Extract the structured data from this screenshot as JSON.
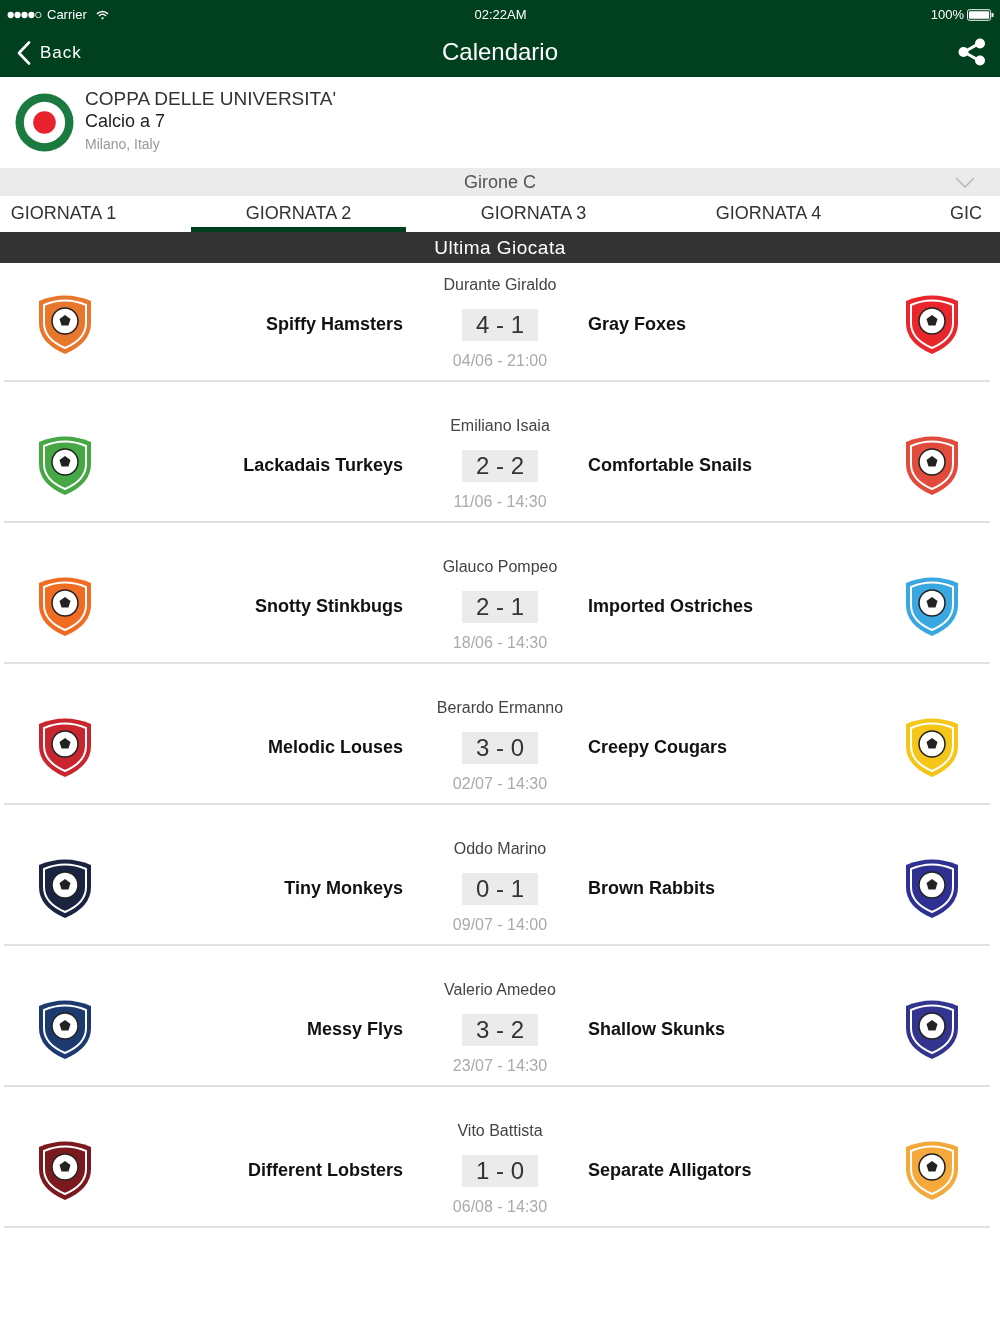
{
  "status_bar": {
    "carrier": "Carrier",
    "time": "02:22AM",
    "battery": "100%"
  },
  "nav_bar": {
    "back": "Back",
    "title": "Calendario"
  },
  "tournament": {
    "name": "COPPA DELLE UNIVERSITA'",
    "sport": "Calcio a 7",
    "location": "Milano, Italy"
  },
  "group_selector": {
    "label": "Girone C"
  },
  "tabs": [
    {
      "label": "GIORNATA 1",
      "selected": false
    },
    {
      "label": "GIORNATA 2",
      "selected": true
    },
    {
      "label": "GIORNATA 3",
      "selected": false
    },
    {
      "label": "GIORNATA 4",
      "selected": false
    },
    {
      "label": "GIC",
      "selected": false
    }
  ],
  "section_header": "Ultima Giocata",
  "matches": [
    {
      "referee": "Durante Giraldo",
      "home": {
        "name": "Spiffy Hamsters",
        "color": "#e8772e"
      },
      "score": "4 - 1",
      "away": {
        "name": "Gray Foxes",
        "color": "#e8262b"
      },
      "date": "04/06 - 21:00"
    },
    {
      "referee": "Emiliano Isaia",
      "home": {
        "name": "Lackadais Turkeys",
        "color": "#45a845"
      },
      "score": "2 - 2",
      "away": {
        "name": "Comfortable Snails",
        "color": "#e24a3b"
      },
      "date": "11/06 - 14:30"
    },
    {
      "referee": "Glauco Pompeo",
      "home": {
        "name": "Snotty Stinkbugs",
        "color": "#ef6c22"
      },
      "score": "2 - 1",
      "away": {
        "name": "Imported Ostriches",
        "color": "#3aa8e0"
      },
      "date": "18/06 - 14:30"
    },
    {
      "referee": "Berardo Ermanno",
      "home": {
        "name": "Melodic Louses",
        "color": "#c8252f"
      },
      "score": "3 - 0",
      "away": {
        "name": "Creepy Cougars",
        "color": "#f5c518"
      },
      "date": "02/07 - 14:30"
    },
    {
      "referee": "Oddo Marino",
      "home": {
        "name": "Tiny Monkeys",
        "color": "#1a2440"
      },
      "score": "0 - 1",
      "away": {
        "name": "Brown Rabbits",
        "color": "#2e3191"
      },
      "date": "09/07 - 14:00"
    },
    {
      "referee": "Valerio Amedeo",
      "home": {
        "name": "Messy Flys",
        "color": "#1d3a6e"
      },
      "score": "3 - 2",
      "away": {
        "name": "Shallow Skunks",
        "color": "#33348e"
      },
      "date": "23/07 - 14:30"
    },
    {
      "referee": "Vito Battista",
      "home": {
        "name": "Different Lobsters",
        "color": "#7a1a1f"
      },
      "score": "1 - 0",
      "away": {
        "name": "Separate Alligators",
        "color": "#f4a93a"
      },
      "date": "06/08 - 14:30"
    }
  ]
}
